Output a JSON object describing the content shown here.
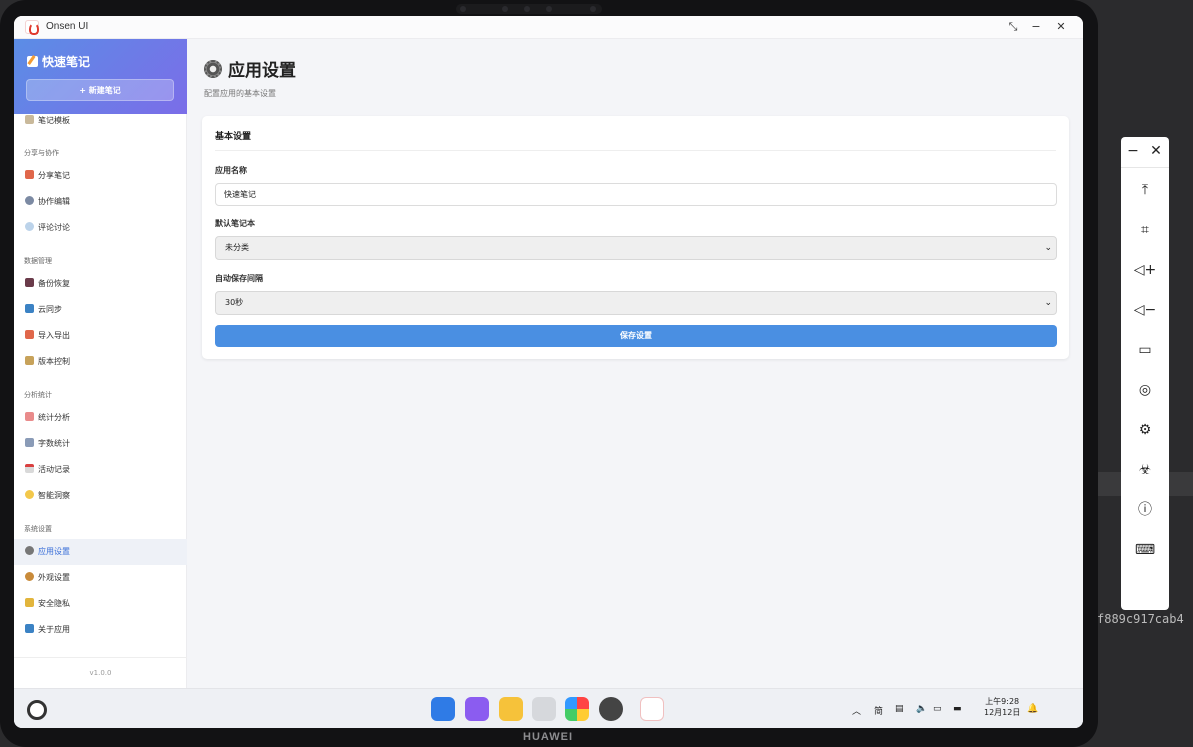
{
  "device": {
    "brand": "HUAWEI"
  },
  "window": {
    "title": "Onsen UI"
  },
  "sidebar": {
    "app_title": "快速笔记",
    "new_note_button": "+ 新建笔记",
    "top_item": "笔记模板",
    "sections": [
      {
        "title": "分享与协作",
        "items": [
          "分享笔记",
          "协作编辑",
          "评论讨论"
        ]
      },
      {
        "title": "数据管理",
        "items": [
          "备份恢复",
          "云同步",
          "导入导出",
          "版本控制"
        ]
      },
      {
        "title": "分析统计",
        "items": [
          "统计分析",
          "字数统计",
          "活动记录",
          "智能洞察"
        ]
      },
      {
        "title": "系统设置",
        "items": [
          "应用设置",
          "外观设置",
          "安全隐私",
          "关于应用"
        ]
      }
    ],
    "active_item": "应用设置",
    "version": "v1.0.0"
  },
  "main": {
    "page_title": "应用设置",
    "page_subtitle": "配置应用的基本设置",
    "card_title": "基本设置",
    "fields": {
      "app_name_label": "应用名称",
      "app_name_value": "快速笔记",
      "default_notebook_label": "默认笔记本",
      "default_notebook_value": "未分类",
      "autosave_label": "自动保存间隔",
      "autosave_value": "30秒"
    },
    "save_button": "保存设置"
  },
  "taskbar": {
    "dock_apps": [
      "app-grid-icon",
      "multitask-icon",
      "notes-icon",
      "trash-icon",
      "gallery-icon",
      "settings-icon",
      "onsen-app-icon"
    ],
    "ime_indicator": "简",
    "time": "上午9:28",
    "date": "12月12日"
  },
  "floating_toolbar": {
    "items": [
      "scroll-to-top-icon",
      "crop-icon",
      "volume-up-icon",
      "volume-down-icon",
      "battery-icon",
      "globe-icon",
      "settings-icon",
      "debug-icon",
      "info-icon",
      "keyboard-icon"
    ]
  },
  "background_text": "f889c917cab4",
  "colors": {
    "accent": "#4a8fe2",
    "header_gradient_start": "#5b8de6",
    "header_gradient_end": "#7b6de8",
    "active_text": "#3a6fd8"
  }
}
